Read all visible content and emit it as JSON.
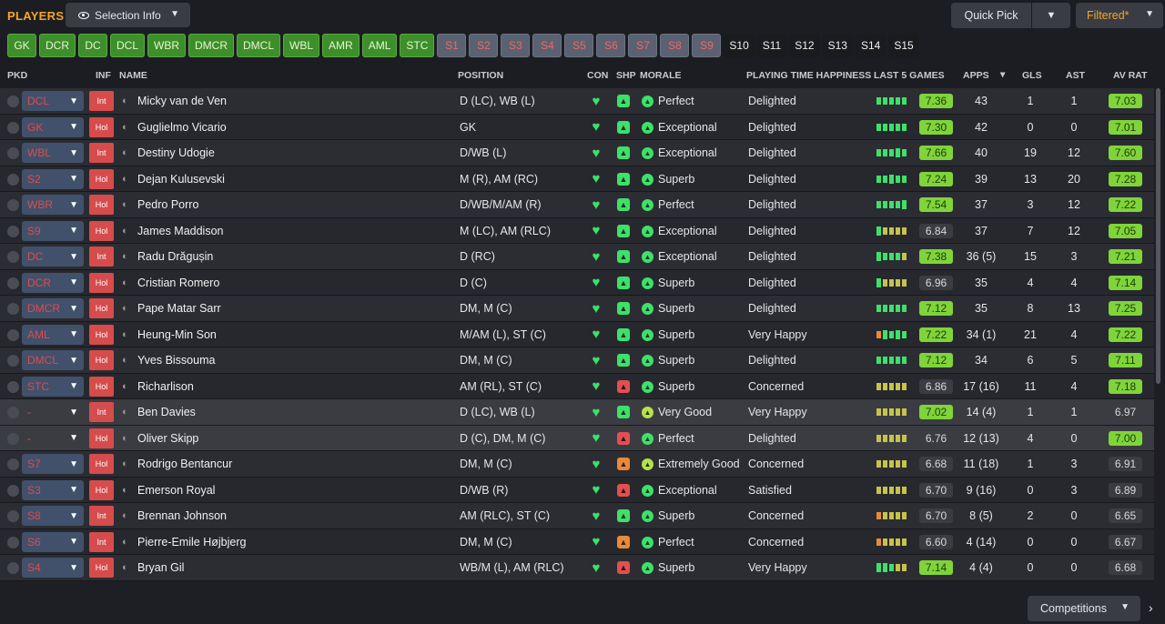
{
  "header": {
    "title": "PLAYERS",
    "selection_info": "Selection Info",
    "quick_pick": "Quick Pick",
    "filtered": "Filtered*",
    "competitions": "Competitions"
  },
  "chips": [
    {
      "label": "GK",
      "kind": "green"
    },
    {
      "label": "DCR",
      "kind": "green"
    },
    {
      "label": "DC",
      "kind": "green"
    },
    {
      "label": "DCL",
      "kind": "green"
    },
    {
      "label": "WBR",
      "kind": "green"
    },
    {
      "label": "DMCR",
      "kind": "green"
    },
    {
      "label": "DMCL",
      "kind": "green"
    },
    {
      "label": "WBL",
      "kind": "green"
    },
    {
      "label": "AMR",
      "kind": "green"
    },
    {
      "label": "AML",
      "kind": "green"
    },
    {
      "label": "STC",
      "kind": "green"
    },
    {
      "label": "S1",
      "kind": "grey"
    },
    {
      "label": "S2",
      "kind": "grey"
    },
    {
      "label": "S3",
      "kind": "grey"
    },
    {
      "label": "S4",
      "kind": "grey"
    },
    {
      "label": "S5",
      "kind": "grey"
    },
    {
      "label": "S6",
      "kind": "grey"
    },
    {
      "label": "S7",
      "kind": "grey"
    },
    {
      "label": "S8",
      "kind": "grey"
    },
    {
      "label": "S9",
      "kind": "grey"
    },
    {
      "label": "S10",
      "kind": "dark"
    },
    {
      "label": "S11",
      "kind": "dark"
    },
    {
      "label": "S12",
      "kind": "dark"
    },
    {
      "label": "S13",
      "kind": "dark"
    },
    {
      "label": "S14",
      "kind": "dark"
    },
    {
      "label": "S15",
      "kind": "dark"
    }
  ],
  "columns": {
    "pkd": "PKD",
    "inf": "INF",
    "name": "NAME",
    "position": "POSITION",
    "con": "CON",
    "shp": "SHP",
    "morale": "MORALE",
    "pth": "PLAYING TIME HAPPINESS",
    "last5": "LAST 5 GAMES",
    "apps": "APPS",
    "gls": "GLS",
    "ast": "AST",
    "avrat": "AV RAT"
  },
  "players": [
    {
      "pkd": "DCL",
      "inf": "Int",
      "name": "Micky van de Ven",
      "position": "D (LC), WB (L)",
      "shp": "g",
      "morale": "Perfect",
      "pth": "Delighted",
      "l5": "ggggg",
      "l5r": "7.36",
      "l5c": "g",
      "apps": "43",
      "gls": "1",
      "ast": "1",
      "av": "7.03",
      "avc": "g"
    },
    {
      "pkd": "GK",
      "inf": "Hol",
      "name": "Guglielmo Vicario",
      "position": "GK",
      "shp": "g",
      "morale": "Exceptional",
      "pth": "Delighted",
      "l5": "ggggg",
      "l5r": "7.30",
      "l5c": "g",
      "apps": "42",
      "gls": "0",
      "ast": "0",
      "av": "7.01",
      "avc": "g"
    },
    {
      "pkd": "WBL",
      "inf": "Int",
      "name": "Destiny Udogie",
      "position": "D/WB (L)",
      "shp": "g",
      "morale": "Exceptional",
      "pth": "Delighted",
      "l5": "gggGg",
      "l5r": "7.66",
      "l5c": "g",
      "apps": "40",
      "gls": "19",
      "ast": "12",
      "av": "7.60",
      "avc": "g"
    },
    {
      "pkd": "S2",
      "inf": "Hol",
      "name": "Dejan Kulusevski",
      "position": "M (R), AM (RC)",
      "shp": "g",
      "morale": "Superb",
      "pth": "Delighted",
      "l5": "ggGgg",
      "l5r": "7.24",
      "l5c": "g",
      "apps": "39",
      "gls": "13",
      "ast": "20",
      "av": "7.28",
      "avc": "g"
    },
    {
      "pkd": "WBR",
      "inf": "Hol",
      "name": "Pedro Porro",
      "position": "D/WB/M/AM (R)",
      "shp": "g",
      "morale": "Perfect",
      "pth": "Delighted",
      "l5": "ggggG",
      "l5r": "7.54",
      "l5c": "g",
      "apps": "37",
      "gls": "3",
      "ast": "12",
      "av": "7.22",
      "avc": "g"
    },
    {
      "pkd": "S9",
      "inf": "Hol",
      "name": "James Maddison",
      "position": "M (LC), AM (RLC)",
      "shp": "g",
      "morale": "Exceptional",
      "pth": "Delighted",
      "l5": "Gyyyy",
      "l5r": "6.84",
      "l5c": "n",
      "apps": "37",
      "gls": "7",
      "ast": "12",
      "av": "7.05",
      "avc": "g"
    },
    {
      "pkd": "DC",
      "inf": "Int",
      "name": "Radu Drăgușin",
      "position": "D (RC)",
      "shp": "g",
      "morale": "Exceptional",
      "pth": "Delighted",
      "l5": "Ggggy",
      "l5r": "7.38",
      "l5c": "g",
      "apps": "36 (5)",
      "gls": "15",
      "ast": "3",
      "av": "7.21",
      "avc": "g"
    },
    {
      "pkd": "DCR",
      "inf": "Hol",
      "name": "Cristian Romero",
      "position": "D (C)",
      "shp": "g",
      "morale": "Superb",
      "pth": "Delighted",
      "l5": "Gyyyy",
      "l5r": "6.96",
      "l5c": "n",
      "apps": "35",
      "gls": "4",
      "ast": "4",
      "av": "7.14",
      "avc": "g"
    },
    {
      "pkd": "DMCR",
      "inf": "Hol",
      "name": "Pape Matar Sarr",
      "position": "DM, M (C)",
      "shp": "g",
      "morale": "Superb",
      "pth": "Delighted",
      "l5": "ggggg",
      "l5r": "7.12",
      "l5c": "g",
      "apps": "35",
      "gls": "8",
      "ast": "13",
      "av": "7.25",
      "avc": "g"
    },
    {
      "pkd": "AML",
      "inf": "Hol",
      "name": "Heung-Min Son",
      "position": "M/AM (L), ST (C)",
      "shp": "g",
      "morale": "Superb",
      "pth": "Very Happy",
      "l5": "oGgGg",
      "l5r": "7.22",
      "l5c": "g",
      "apps": "34 (1)",
      "gls": "21",
      "ast": "4",
      "av": "7.22",
      "avc": "g"
    },
    {
      "pkd": "DMCL",
      "inf": "Hol",
      "name": "Yves Bissouma",
      "position": "DM, M (C)",
      "shp": "g",
      "morale": "Superb",
      "pth": "Delighted",
      "l5": "ggggg",
      "l5r": "7.12",
      "l5c": "g",
      "apps": "34",
      "gls": "6",
      "ast": "5",
      "av": "7.11",
      "avc": "g"
    },
    {
      "pkd": "STC",
      "inf": "Hol",
      "name": "Richarlison",
      "position": "AM (RL), ST (C)",
      "shp": "r",
      "morale": "Superb",
      "pth": "Concerned",
      "l5": "yyyyy",
      "l5r": "6.86",
      "l5c": "n",
      "apps": "17 (16)",
      "gls": "11",
      "ast": "4",
      "av": "7.18",
      "avc": "g"
    },
    {
      "pkd": "-",
      "inf": "Int",
      "name": "Ben Davies",
      "position": "D (LC), WB (L)",
      "shp": "g",
      "morale": "Very Good",
      "pth": "Very Happy",
      "l5": "yyyyy",
      "l5r": "7.02",
      "l5c": "g",
      "apps": "14 (4)",
      "gls": "1",
      "ast": "1",
      "av": "6.97",
      "avc": "n"
    },
    {
      "pkd": "-",
      "inf": "Hol",
      "name": "Oliver Skipp",
      "position": "D (C), DM, M (C)",
      "shp": "r",
      "morale": "Perfect",
      "pth": "Delighted",
      "l5": "yyyyy",
      "l5r": "6.76",
      "l5c": "n",
      "apps": "12 (13)",
      "gls": "4",
      "ast": "0",
      "av": "7.00",
      "avc": "g"
    },
    {
      "pkd": "S7",
      "inf": "Hol",
      "name": "Rodrigo Bentancur",
      "position": "DM, M (C)",
      "shp": "o",
      "morale": "Extremely Good",
      "pth": "Concerned",
      "l5": "yyyyy",
      "l5r": "6.68",
      "l5c": "n",
      "apps": "11 (18)",
      "gls": "1",
      "ast": "3",
      "av": "6.91",
      "avc": "n"
    },
    {
      "pkd": "S3",
      "inf": "Hol",
      "name": "Emerson Royal",
      "position": "D/WB (R)",
      "shp": "r",
      "morale": "Exceptional",
      "pth": "Satisfied",
      "l5": "yyyyy",
      "l5r": "6.70",
      "l5c": "n",
      "apps": "9 (16)",
      "gls": "0",
      "ast": "3",
      "av": "6.89",
      "avc": "n"
    },
    {
      "pkd": "S8",
      "inf": "Int",
      "name": "Brennan Johnson",
      "position": "AM (RLC), ST (C)",
      "shp": "g",
      "morale": "Superb",
      "pth": "Concerned",
      "l5": "oyyyy",
      "l5r": "6.70",
      "l5c": "n",
      "apps": "8 (5)",
      "gls": "2",
      "ast": "0",
      "av": "6.65",
      "avc": "n"
    },
    {
      "pkd": "S6",
      "inf": "Int",
      "name": "Pierre-Emile Højbjerg",
      "position": "DM, M (C)",
      "shp": "o",
      "morale": "Perfect",
      "pth": "Concerned",
      "l5": "oyyyy",
      "l5r": "6.60",
      "l5c": "n",
      "apps": "4 (14)",
      "gls": "0",
      "ast": "0",
      "av": "6.67",
      "avc": "n"
    },
    {
      "pkd": "S4",
      "inf": "Hol",
      "name": "Bryan Gil",
      "position": "WB/M (L), AM (RLC)",
      "shp": "r",
      "morale": "Superb",
      "pth": "Very Happy",
      "l5": "GGgyy",
      "l5r": "7.14",
      "l5c": "g",
      "apps": "4 (4)",
      "gls": "0",
      "ast": "0",
      "av": "6.68",
      "avc": "n"
    }
  ],
  "highlight_rows": [
    12,
    13
  ]
}
